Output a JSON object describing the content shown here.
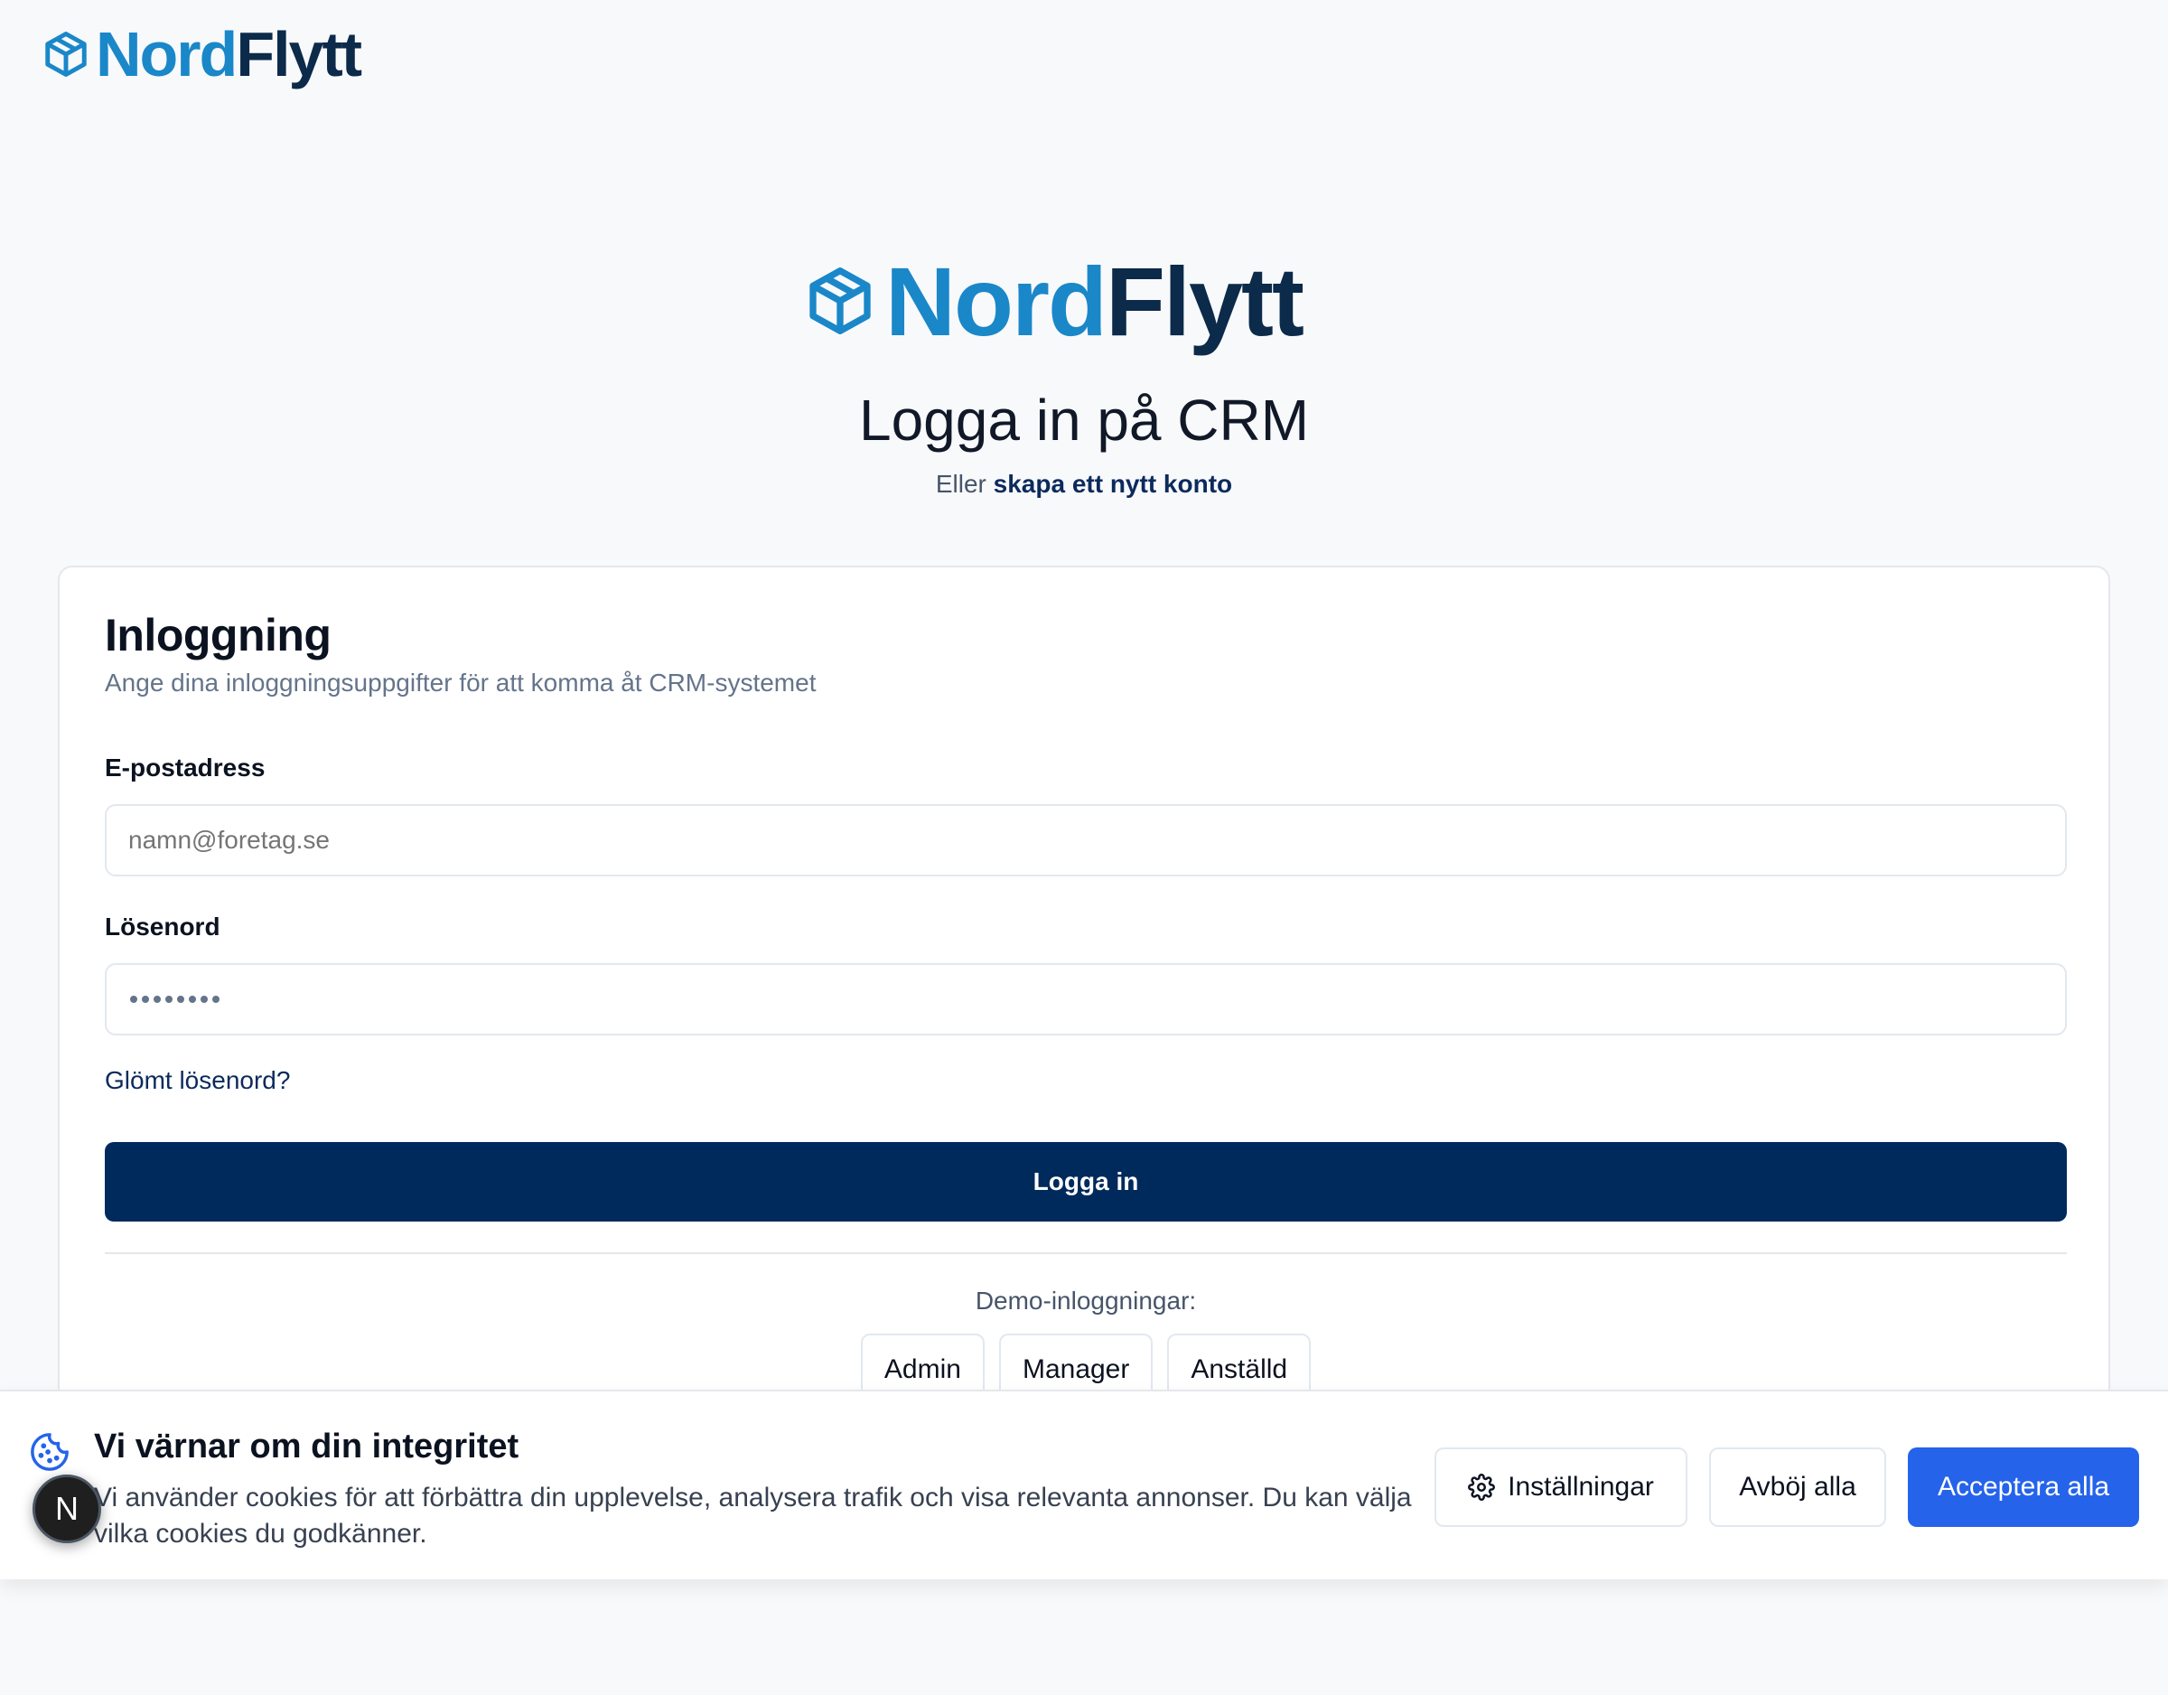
{
  "brand": {
    "nord": "Nord",
    "flytt": "Flytt",
    "nord_color": "#1a87c9",
    "flytt_color": "#0c2a4a"
  },
  "header": {
    "title": "Logga in på CRM",
    "subtitle_prefix": "Eller",
    "subtitle_link": "skapa ett nytt konto"
  },
  "card": {
    "title": "Inloggning",
    "description": "Ange dina inloggningsuppgifter för att komma åt CRM-systemet",
    "email_label": "E-postadress",
    "email_placeholder": "namn@foretag.se",
    "password_label": "Lösenord",
    "password_placeholder": "••••••••",
    "forgot_link": "Glömt lösenord?",
    "login_button": "Logga in",
    "demo_label": "Demo-inloggningar:",
    "demo_buttons": [
      "Admin",
      "Manager",
      "Anställd"
    ]
  },
  "cookie": {
    "title": "Vi värnar om din integritet",
    "text": "Vi använder cookies för att förbättra din upplevelse, analysera trafik och visa relevanta annonser. Du kan välja vilka cookies du godkänner.",
    "settings_button": "Inställningar",
    "reject_button": "Avböj alla",
    "accept_button": "Acceptera alla",
    "icon": "cookie-icon",
    "accent_color": "#2563eb"
  },
  "dev_badge": {
    "letter": "N"
  },
  "colors": {
    "primary_button": "#002a5c",
    "background": "#f8f9fb"
  }
}
